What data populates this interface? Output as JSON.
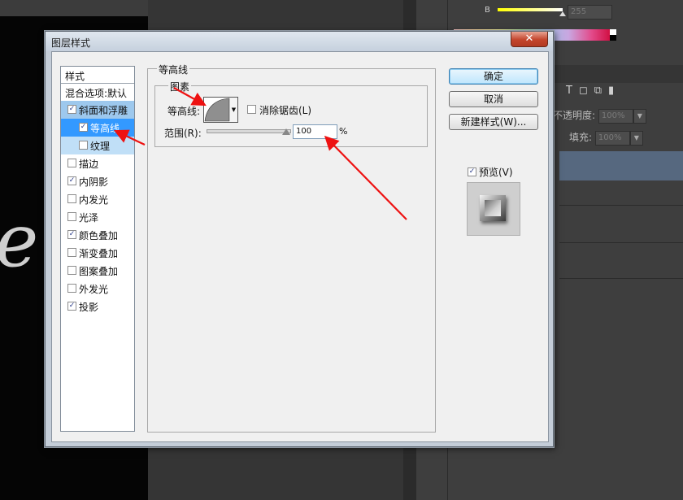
{
  "background": {
    "color_panel": {
      "channel_label": "B",
      "channel_value": "255"
    },
    "layers_panel": {
      "opacity_label": "不透明度:",
      "opacity_value": "100%",
      "fill_label": "填充:",
      "fill_value": "100%",
      "icons": [
        "type-icon",
        "transform-icon",
        "smart-object-icon",
        "lock-icon"
      ]
    }
  },
  "dialog": {
    "title": "图层样式",
    "close_symbol": "✕",
    "styles_list": {
      "header": "样式",
      "blend_options": "混合选项:默认",
      "items": [
        {
          "label": "斜面和浮雕",
          "checked": true,
          "state": "selected"
        },
        {
          "label": "等高线",
          "checked": true,
          "state": "active-sub"
        },
        {
          "label": "纹理",
          "checked": false,
          "state": "sub"
        },
        {
          "label": "描边",
          "checked": false
        },
        {
          "label": "内阴影",
          "checked": true
        },
        {
          "label": "内发光",
          "checked": false
        },
        {
          "label": "光泽",
          "checked": false
        },
        {
          "label": "颜色叠加",
          "checked": true
        },
        {
          "label": "渐变叠加",
          "checked": false
        },
        {
          "label": "图案叠加",
          "checked": false
        },
        {
          "label": "外发光",
          "checked": false
        },
        {
          "label": "投影",
          "checked": true
        }
      ]
    },
    "contour_panel": {
      "group_title": "等高线",
      "subgroup_title": "图素",
      "contour_label": "等高线:",
      "anti_alias_label": "消除锯齿(L)",
      "anti_alias_checked": false,
      "range_label": "范围(R):",
      "range_value": "100",
      "range_percent": 100,
      "range_unit": "%"
    },
    "buttons": {
      "ok": "确定",
      "cancel": "取消",
      "new_style": "新建样式(W)..."
    },
    "preview": {
      "label": "预览(V)",
      "checked": true
    }
  },
  "annotation_color": "#ee1111"
}
